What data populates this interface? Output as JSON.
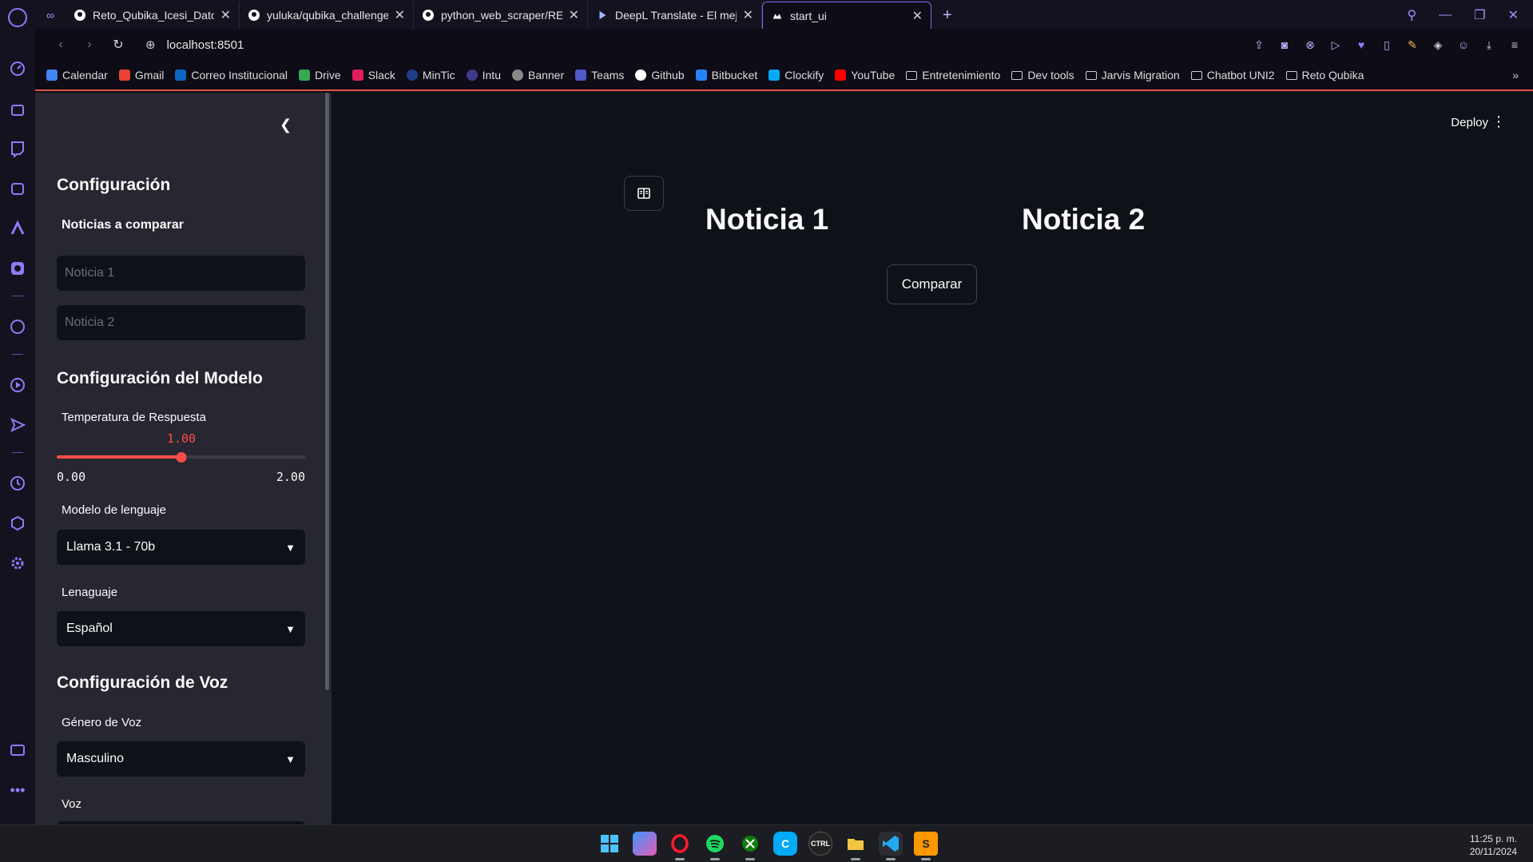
{
  "browser": {
    "tabs": [
      {
        "title": "Reto_Qubika_Icesi_Datos",
        "icon": "github-icon"
      },
      {
        "title": "yuluka/qubika_challenge",
        "icon": "github-icon"
      },
      {
        "title": "python_web_scraper/REA",
        "icon": "github-icon"
      },
      {
        "title": "DeepL Translate - El mejo",
        "icon": "deepl-icon"
      },
      {
        "title": "start_ui",
        "icon": "streamlit-icon",
        "active": true
      }
    ],
    "url": "localhost:8501",
    "bookmarks": [
      {
        "label": "Calendar",
        "color": "#4285f4"
      },
      {
        "label": "Gmail",
        "color": "#ea4335"
      },
      {
        "label": "Correo Institucional",
        "color": "#0a66c2"
      },
      {
        "label": "Drive",
        "color": "#34a853"
      },
      {
        "label": "Slack",
        "color": "#e01e5a"
      },
      {
        "label": "MinTic",
        "color": "#1f3c88"
      },
      {
        "label": "Intu",
        "color": "#3d3a8c"
      },
      {
        "label": "Banner",
        "color": "#888888"
      },
      {
        "label": "Teams",
        "color": "#5059c9"
      },
      {
        "label": "Github",
        "color": "#ffffff"
      },
      {
        "label": "Bitbucket",
        "color": "#2684ff"
      },
      {
        "label": "Clockify",
        "color": "#03a9f4"
      },
      {
        "label": "YouTube",
        "color": "#ff0000"
      }
    ],
    "bookmark_folders": [
      "Entretenimiento",
      "Dev tools",
      "Jarvis Migration",
      "Chatbot UNI2",
      "Reto Qubika"
    ]
  },
  "sidebar": {
    "heading": "Configuración",
    "news_label": "Noticias a comparar",
    "news1_placeholder": "Noticia 1",
    "news2_placeholder": "Noticia 2",
    "model_heading": "Configuración del Modelo",
    "temperature_label": "Temperatura de Respuesta",
    "temperature_value": "1.00",
    "temperature_fraction": 0.5,
    "temperature_min": "0.00",
    "temperature_max": "2.00",
    "model_label": "Modelo de lenguaje",
    "model_value": "Llama 3.1 - 70b",
    "language_label": "Lenaguaje",
    "language_value": "Español",
    "voice_heading": "Configuración de Voz",
    "voice_gender_label": "Género de Voz",
    "voice_gender_value": "Masculino",
    "voice_label": "Voz"
  },
  "main": {
    "deploy_label": "Deploy",
    "news1_title": "Noticia 1",
    "news2_title": "Noticia 2",
    "compare_button": "Comparar"
  },
  "taskbar": {
    "time": "11:25 p. m.",
    "date": "20/11/2024"
  },
  "colors": {
    "accent": "#ff4b4b",
    "app_bg": "#0e1117",
    "sidebar_bg": "#262730",
    "opera_accent": "#8b7cf6"
  }
}
